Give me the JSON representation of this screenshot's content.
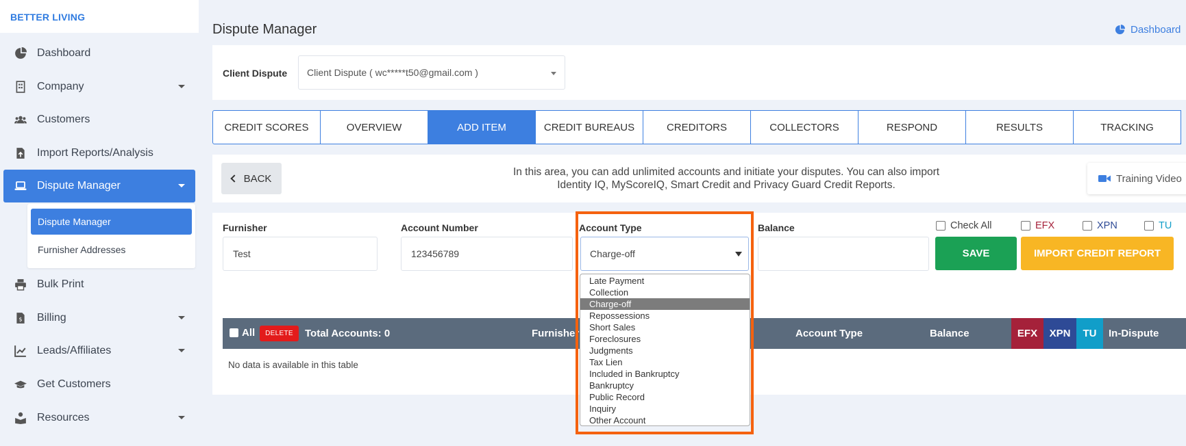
{
  "brand": "BETTER LIVING",
  "sidebar": {
    "items": [
      {
        "label": "Dashboard",
        "icon": "pie-chart-icon"
      },
      {
        "label": "Company",
        "icon": "building-icon"
      },
      {
        "label": "Customers",
        "icon": "users-icon"
      },
      {
        "label": "Import Reports/Analysis",
        "icon": "file-upload-icon"
      },
      {
        "label": "Dispute Manager",
        "icon": "laptop-icon"
      },
      {
        "label": "Bulk Print",
        "icon": "printer-icon"
      },
      {
        "label": "Billing",
        "icon": "invoice-icon"
      },
      {
        "label": "Leads/Affiliates",
        "icon": "chart-line-icon"
      },
      {
        "label": "Get Customers",
        "icon": "graduation-cap-icon"
      },
      {
        "label": "Resources",
        "icon": "book-reader-icon"
      }
    ],
    "submenu": [
      "Dispute Manager",
      "Furnisher Addresses"
    ]
  },
  "header": {
    "title": "Dispute Manager",
    "dashboard_link": "Dashboard"
  },
  "client": {
    "label": "Client Dispute",
    "value": "Client Dispute ( wc*****t50@gmail.com )"
  },
  "tabs": [
    "CREDIT SCORES",
    "OVERVIEW",
    "ADD ITEM",
    "CREDIT BUREAUS",
    "CREDITORS",
    "COLLECTORS",
    "RESPOND",
    "RESULTS",
    "TRACKING"
  ],
  "info": {
    "back": "BACK",
    "line1": "In this area, you can add unlimited accounts and initiate your disputes. You can also import",
    "line2": "Identity IQ, MyScoreIQ, Smart Credit and Privacy Guard Credit Reports.",
    "training": "Training Video"
  },
  "form": {
    "furnisher_label": "Furnisher",
    "furnisher_value": "Test",
    "account_number_label": "Account Number",
    "account_number_value": "123456789",
    "account_type_label": "Account Type",
    "account_type_value": "Charge-off",
    "balance_label": "Balance",
    "balance_value": "",
    "check_all": "Check All",
    "efx": "EFX",
    "xpn": "XPN",
    "tu": "TU",
    "save": "SAVE",
    "import": "IMPORT CREDIT REPORT"
  },
  "table": {
    "all": "All",
    "delete": "DELETE",
    "total": "Total Accounts: 0",
    "furnisher": "Furnisher",
    "account_type": "Account Type",
    "balance": "Balance",
    "efx": "EFX",
    "xpn": "XPN",
    "tu": "TU",
    "in_dispute": "In-Dispute",
    "empty": "No data is available in this table"
  },
  "dropdown_options": [
    "Late Payment",
    "Collection",
    "Charge-off",
    "Repossessions",
    "Short Sales",
    "Foreclosures",
    "Judgments",
    "Tax Lien",
    "Included in Bankruptcy",
    "Bankruptcy",
    "Public Record",
    "Inquiry",
    "Other Account"
  ],
  "colors": {
    "accent": "#3d7fe0",
    "save": "#1ba155",
    "import": "#f8b624",
    "efx": "#a5213a",
    "xpn": "#2e4a96",
    "tu": "#119ec9",
    "highlight": "#f5620f"
  }
}
